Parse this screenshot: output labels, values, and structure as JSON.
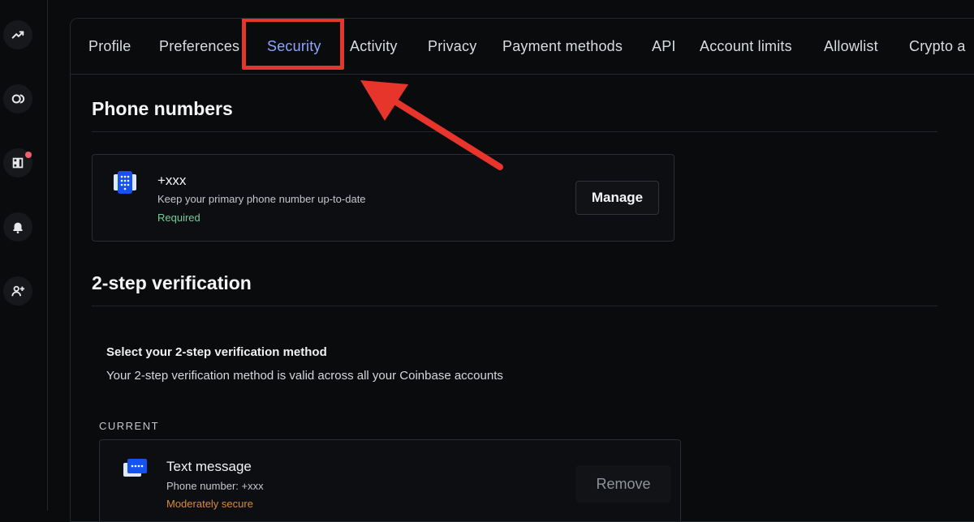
{
  "sidebar": {
    "items": [
      {
        "icon": "trending-up-icon"
      },
      {
        "icon": "coinbase-one-icon"
      },
      {
        "icon": "dashboard-icon",
        "has_notification_dot": true
      },
      {
        "icon": "bell-icon"
      },
      {
        "icon": "add-user-icon"
      }
    ]
  },
  "tabs": [
    {
      "label": "Profile"
    },
    {
      "label": "Preferences"
    },
    {
      "label": "Security",
      "active": true
    },
    {
      "label": "Activity"
    },
    {
      "label": "Privacy"
    },
    {
      "label": "Payment methods"
    },
    {
      "label": "API"
    },
    {
      "label": "Account limits"
    },
    {
      "label": "Allowlist"
    },
    {
      "label": "Crypto a"
    }
  ],
  "phone_section": {
    "title": "Phone numbers",
    "card": {
      "number": "+xxx",
      "description": "Keep your primary phone number up-to-date",
      "status": "Required",
      "button_label": "Manage"
    }
  },
  "two_step_section": {
    "title": "2-step verification",
    "select_heading": "Select your 2-step verification method",
    "select_description": "Your 2-step verification method is valid across all your Coinbase accounts",
    "current_label": "CURRENT",
    "current_method": {
      "title": "Text message",
      "detail": "Phone number: +xxx",
      "security_level": "Moderately secure",
      "button_label": "Remove"
    }
  },
  "colors": {
    "background": "#0a0b0d",
    "active_tab": "#8aa6ff",
    "highlight": "#e8352b",
    "required_green": "#6fcf97",
    "warning_orange": "#d98c2a",
    "icon_blue": "#1652f0"
  }
}
